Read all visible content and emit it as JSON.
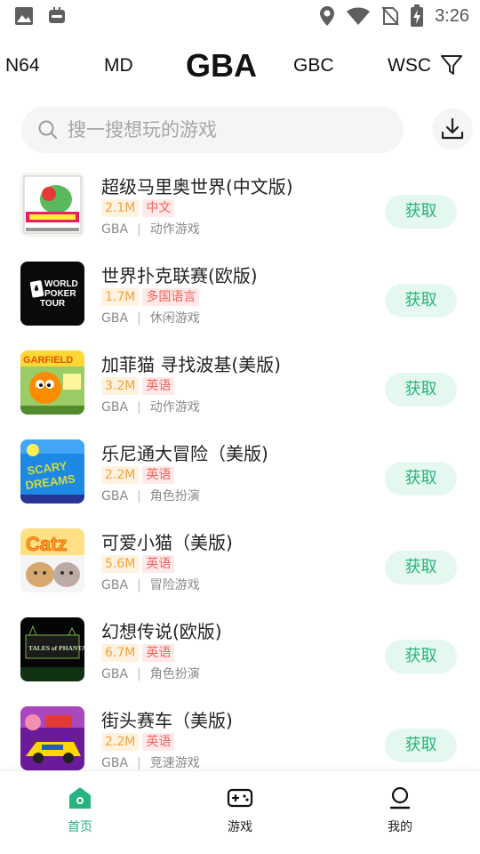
{
  "status_bar": {
    "time": "3:26",
    "left_icons": [
      "gallery-icon",
      "app-notification-icon"
    ],
    "right_icons": [
      "location-icon",
      "wifi-icon",
      "no-sim-icon",
      "battery-charging-icon"
    ]
  },
  "platform_tabs": [
    {
      "label": "N64",
      "active": false
    },
    {
      "label": "MD",
      "active": false
    },
    {
      "label": "GBA",
      "active": true
    },
    {
      "label": "GBC",
      "active": false
    },
    {
      "label": "WSC",
      "active": false
    }
  ],
  "search": {
    "placeholder": "搜一搜想玩的游戏",
    "value": ""
  },
  "games": [
    {
      "title": "超级马里奥世界(中文版)",
      "size": "2.1M",
      "language": "中文",
      "platform": "GBA",
      "genre": "动作游戏",
      "action": "获取"
    },
    {
      "title": "世界扑克联赛(欧版)",
      "size": "1.7M",
      "language": "多国语言",
      "platform": "GBA",
      "genre": "休闲游戏",
      "action": "获取"
    },
    {
      "title": "加菲猫 寻找波基(美版)",
      "size": "3.2M",
      "language": "英语",
      "platform": "GBA",
      "genre": "动作游戏",
      "action": "获取"
    },
    {
      "title": "乐尼通大冒险（美版)",
      "size": "2.2M",
      "language": "英语",
      "platform": "GBA",
      "genre": "角色扮演",
      "action": "获取"
    },
    {
      "title": "可爱小猫（美版)",
      "size": "5.6M",
      "language": "英语",
      "platform": "GBA",
      "genre": "冒险游戏",
      "action": "获取"
    },
    {
      "title": "幻想传说(欧版)",
      "size": "6.7M",
      "language": "英语",
      "platform": "GBA",
      "genre": "角色扮演",
      "action": "获取"
    },
    {
      "title": "街头赛车（美版)",
      "size": "2.2M",
      "language": "英语",
      "platform": "GBA",
      "genre": "竞速游戏",
      "action": "获取"
    }
  ],
  "cover_texts": {
    "world_poker": [
      "WORLD",
      "POKER",
      "TOUR"
    ],
    "garfield": "GARFIELD",
    "scary_dreams": [
      "SCARY",
      "DREAMS"
    ],
    "catz": "Catz",
    "phantasia": "TALES of PHANTASIA"
  },
  "bottom_nav": [
    {
      "label": "首页",
      "icon": "home-icon",
      "active": true
    },
    {
      "label": "游戏",
      "icon": "gamepad-icon",
      "active": false
    },
    {
      "label": "我的",
      "icon": "profile-icon",
      "active": false
    }
  ],
  "colors": {
    "accent": "#25b480",
    "accent_bg": "#e5f8f0",
    "size_badge": "#f2a23c",
    "lang_badge": "#f0645a"
  }
}
